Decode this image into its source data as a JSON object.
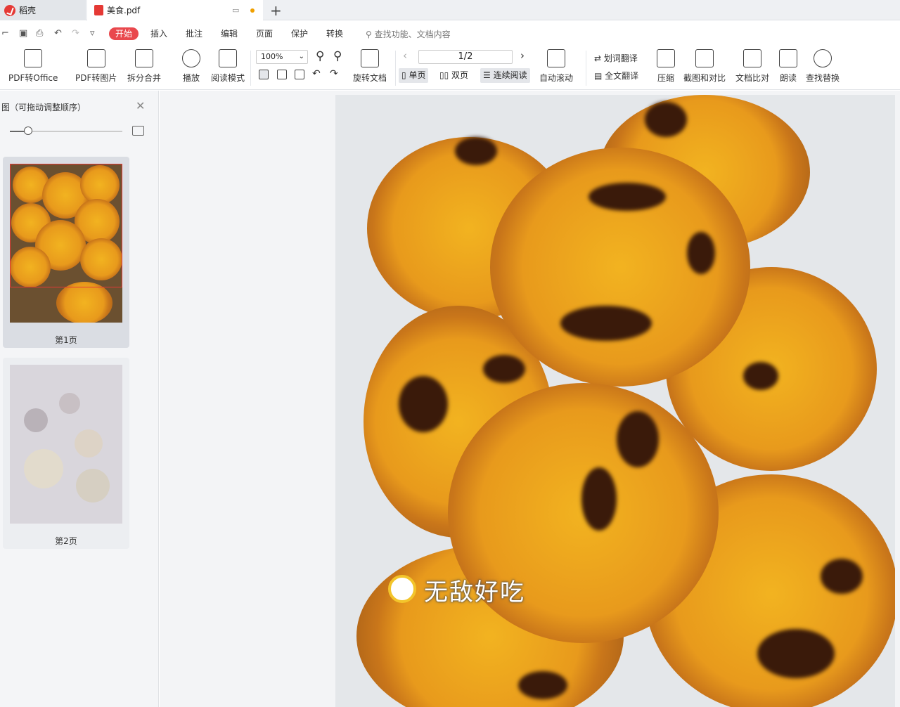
{
  "tabs": {
    "home": "稻壳",
    "doc": "美食.pdf",
    "new": "+"
  },
  "menu": [
    "开始",
    "插入",
    "批注",
    "编辑",
    "页面",
    "保护",
    "转换"
  ],
  "search_placeholder": "查找功能、文档内容",
  "ribbon": {
    "pdf_office": "PDF转Office",
    "pdf_image": "PDF转图片",
    "split_merge": "拆分合并",
    "play": "播放",
    "read_mode": "阅读模式",
    "zoom": "100%",
    "rotate": "旋转文档",
    "page_indicator": "1/2",
    "single": "单页",
    "double": "双页",
    "continuous": "连续阅读",
    "auto_scroll": "自动滚动",
    "word_translate": "划词翻译",
    "full_translate": "全文翻译",
    "compress": "压缩",
    "screenshot": "截图和对比",
    "compare": "文档比对",
    "read_aloud": "朗读",
    "find_replace": "查找替换"
  },
  "sidebar": {
    "title": "图（可拖动调整顺序）",
    "pages": [
      {
        "label": "第1页"
      },
      {
        "label": "第2页"
      }
    ]
  },
  "page": {
    "caption": "无敌好吃"
  },
  "colors": {
    "accent": "#e9484d",
    "toolbar_bg": "#ffffff",
    "canvas_bg": "#f3f4f6"
  }
}
